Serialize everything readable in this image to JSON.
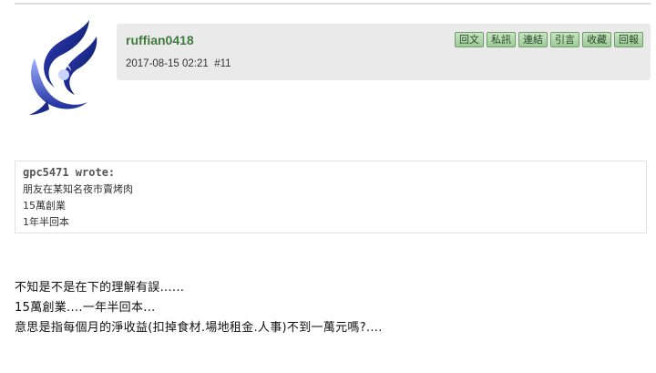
{
  "post": {
    "username": "ruffian0418",
    "date": "2017-08-15 02:21",
    "floor": "#11",
    "buttons": [
      "回文",
      "私訊",
      "連結",
      "引言",
      "收藏",
      "回報"
    ]
  },
  "quote": {
    "author": "gpc5471 wrote:",
    "lines": [
      "朋友在某知名夜市賣烤肉",
      "15萬創業",
      "1年半回本"
    ]
  },
  "body": {
    "lines": [
      "不知是不是在下的理解有誤......",
      "15萬創業....一年半回本...",
      "意思是指每個月的淨收益(扣掉食材.場地租金.人事)不到一萬元嗎?...."
    ]
  },
  "colors": {
    "username": "#3f7a3f",
    "button_bg": "#b6d9b0",
    "header_bg": "#eaeaea"
  }
}
